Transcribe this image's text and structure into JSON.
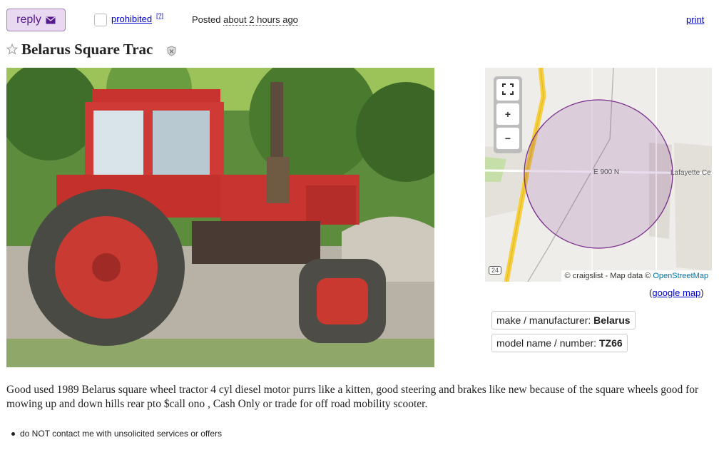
{
  "toolbar": {
    "reply_label": "reply",
    "prohibited_label": "prohibited",
    "help_label": "[?]",
    "posted_prefix": "Posted",
    "posted_ago": "about 2 hours ago",
    "print_label": "print"
  },
  "post": {
    "title": "Belarus Square Trac",
    "body": "Good used 1989 Belarus square wheel tractor 4 cyl diesel motor purrs like a kitten, good steering and brakes like new because of the square wheels good for mowing up and down hills rear pto $call ono , Cash Only or trade for off road mobility scooter.",
    "notice": "do NOT contact me with unsolicited services or offers"
  },
  "map": {
    "road_label_1": "E 900 N",
    "road_label_2": "Lafayette Ce",
    "route_badge": "24",
    "attribution_prefix": "© craigslist - Map data ©",
    "attribution_link": "OpenStreetMap",
    "google_map_open": "(",
    "google_map_label": "google map",
    "google_map_close": ")",
    "circle_color": "#7b2d8e",
    "zoom_in": "+",
    "zoom_out": "−"
  },
  "attributes": [
    {
      "label": "make / manufacturer:",
      "value": "Belarus"
    },
    {
      "label": "model name / number:",
      "value": "TZ66"
    }
  ],
  "colors": {
    "link": "#0000cc",
    "reply_bg": "#e9d9f0",
    "reply_text": "#551a8b"
  },
  "icons": {
    "reply": "mail-icon",
    "favorite": "star-icon",
    "hide": "hide-icon",
    "fullscreen": "fullscreen-icon"
  }
}
